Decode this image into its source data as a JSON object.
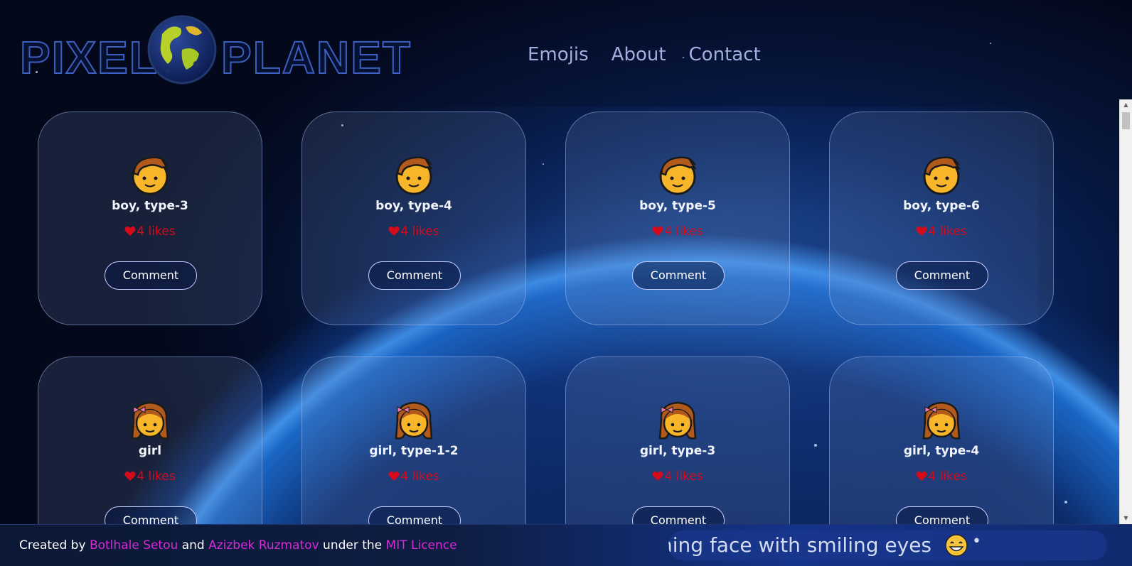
{
  "header": {
    "logo_left": "PIXEL",
    "logo_right": "PLANET",
    "nav": [
      "Emojis",
      "About",
      "Contact"
    ]
  },
  "cards": [
    {
      "name": "boy, type-3",
      "likes": "4 likes",
      "comment": "Comment",
      "emoji": "boy-emoji-icon"
    },
    {
      "name": "boy, type-4",
      "likes": "4 likes",
      "comment": "Comment",
      "emoji": "boy-emoji-icon"
    },
    {
      "name": "boy, type-5",
      "likes": "4 likes",
      "comment": "Comment",
      "emoji": "boy-emoji-icon"
    },
    {
      "name": "boy, type-6",
      "likes": "4 likes",
      "comment": "Comment",
      "emoji": "boy-emoji-icon"
    },
    {
      "name": "girl",
      "likes": "4 likes",
      "comment": "Comment",
      "emoji": "girl-emoji-icon"
    },
    {
      "name": "girl, type-1-2",
      "likes": "4 likes",
      "comment": "Comment",
      "emoji": "girl-emoji-icon"
    },
    {
      "name": "girl, type-3",
      "likes": "4 likes",
      "comment": "Comment",
      "emoji": "girl-emoji-icon"
    },
    {
      "name": "girl, type-4",
      "likes": "4 likes",
      "comment": "Comment",
      "emoji": "girl-emoji-icon"
    }
  ],
  "footer": {
    "created_by": "Created by",
    "author1": "Botlhale Setou",
    "and": "and",
    "author2": "Azizbek Ruzmatov",
    "under": "under the",
    "licence": "MIT Licence",
    "ticker_text": "ning face with smiling eyes",
    "ticker_emoji": "grinning-face-icon",
    "ticker_separator": "•"
  },
  "colors": {
    "like": "#d60a1b",
    "link": "#d62ad8",
    "nav": "#a3aee0"
  }
}
